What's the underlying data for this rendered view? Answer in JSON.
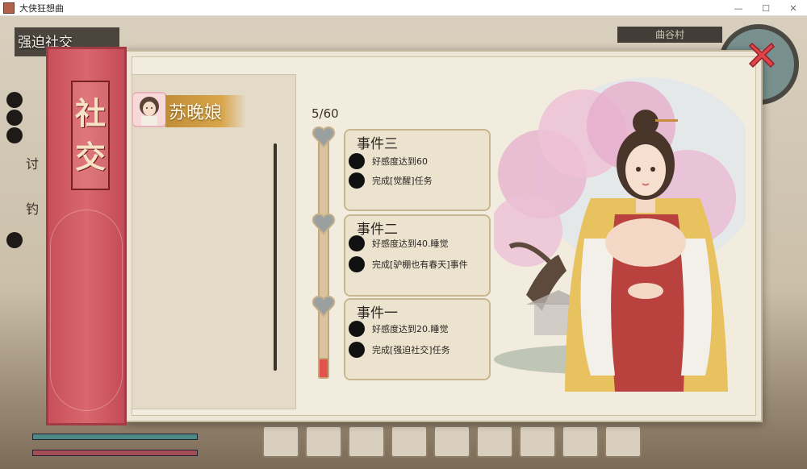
{
  "window": {
    "title": "大侠狂想曲"
  },
  "hud": {
    "top_left_label": "强迫社交",
    "side_labels": [
      "讨",
      "钓"
    ],
    "location": "曲谷村"
  },
  "panel": {
    "banner_title": [
      "社",
      "交"
    ]
  },
  "character": {
    "name": "苏晚娘"
  },
  "progress": {
    "text": "5/60",
    "current": 5,
    "max": 60
  },
  "events": [
    {
      "title": "事件三",
      "conditions": [
        "好感度达到60",
        "完成[觉醒]任务"
      ]
    },
    {
      "title": "事件二",
      "conditions": [
        "好感度达到40.睡觉",
        "完成[驴棚也有春天]事件"
      ]
    },
    {
      "title": "事件一",
      "conditions": [
        "好感度达到20.睡觉",
        "完成[强迫社交]任务"
      ]
    }
  ],
  "colors": {
    "banner_red": "#c7505a",
    "progress_fill": "#e2534f",
    "close_red": "#e0444a"
  },
  "icons": {
    "close": "close-x-icon",
    "heart": "heart-icon",
    "event_dot": "black-dot-icon"
  }
}
